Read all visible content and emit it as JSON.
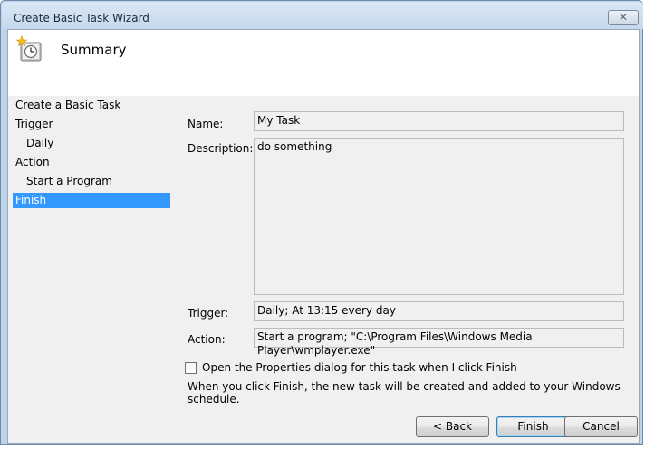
{
  "window": {
    "title": "Create Basic Task Wizard",
    "close_glyph": "✕"
  },
  "header": {
    "title": "Summary",
    "icon": "task-scheduler-clock-icon"
  },
  "sidebar": {
    "items": [
      {
        "label": "Create a Basic Task",
        "level": 0,
        "active": false
      },
      {
        "label": "Trigger",
        "level": 0,
        "active": false
      },
      {
        "label": "Daily",
        "level": 1,
        "active": false
      },
      {
        "label": "Action",
        "level": 0,
        "active": false
      },
      {
        "label": "Start a Program",
        "level": 1,
        "active": false
      },
      {
        "label": "Finish",
        "level": 0,
        "active": true
      }
    ]
  },
  "form": {
    "name_label": "Name:",
    "name_value": "My Task",
    "description_label": "Description:",
    "description_value": "do something",
    "trigger_label": "Trigger:",
    "trigger_value": "Daily; At 13:15 every day",
    "action_label": "Action:",
    "action_value": "Start a program; \"C:\\Program Files\\Windows Media Player\\wmplayer.exe\"",
    "open_properties_label": "Open the Properties dialog for this task when I click Finish",
    "open_properties_checked": false,
    "info_text": "When you click Finish, the new task will be created and added to your Windows schedule."
  },
  "buttons": {
    "back": "< Back",
    "finish": "Finish",
    "cancel": "Cancel"
  },
  "colors": {
    "selection": "#3399ff",
    "frame": "#bfd3ea"
  }
}
